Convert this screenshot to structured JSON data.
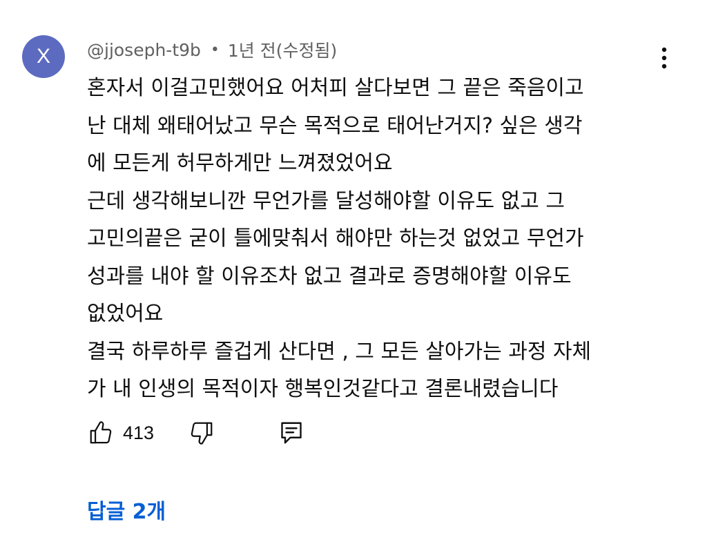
{
  "comment": {
    "author": {
      "handle": "@jjoseph-t9b",
      "avatar_letter": "X",
      "avatar_color": "#5c6bc0"
    },
    "meta": {
      "separator": "•",
      "timestamp": "1년 전(수정됨)"
    },
    "body_lines": [
      "혼자서 이걸고민했어요 어처피 살다보면 그 끝은 죽음이고",
      "난 대체 왜태어났고 무슨 목적으로 태어난거지? 싶은 생각",
      "에 모든게 허무하게만 느껴졌었어요",
      "근데 생각해보니깐 무언가를 달성해야할 이유도 없고 그",
      "고민의끝은 굳이 틀에맞춰서 해야만 하는것 없었고 무언가",
      "성과를 내야 할 이유조차 없고 결과로 증명해야할 이유도",
      "없었어요",
      "결국 하루하루 즐겁게 산다면 , 그 모든 살아가는 과정 자체",
      "가 내 인생의 목적이자 행복인것같다고 결론내렸습니다"
    ],
    "actions": {
      "like_count": "413",
      "like_icon": "thumbs-up-icon",
      "dislike_icon": "thumbs-down-icon",
      "reply_icon": "reply-comment-icon",
      "more_icon": "more-vertical-icon"
    },
    "replies": {
      "label": "답글 2개",
      "color": "#065fd4"
    }
  }
}
